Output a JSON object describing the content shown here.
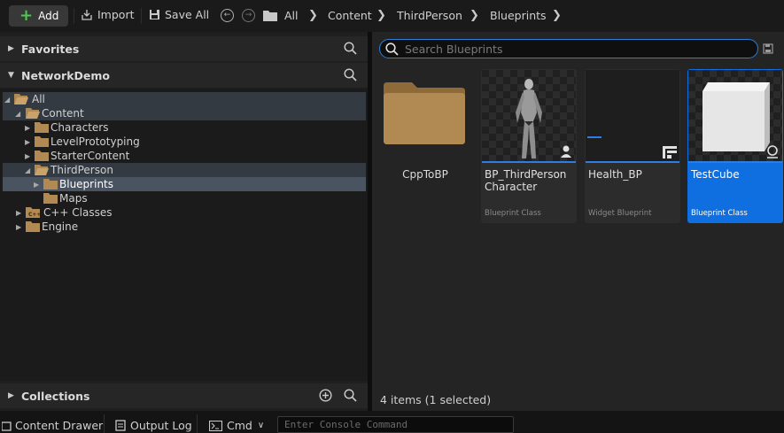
{
  "toolbar": {
    "add_label": "Add",
    "import_label": "Import",
    "save_all_label": "Save All",
    "breadcrumbs": [
      "All",
      "Content",
      "ThirdPerson",
      "Blueprints"
    ]
  },
  "sidebar": {
    "favorites_label": "Favorites",
    "project_label": "NetworkDemo",
    "collections_label": "Collections",
    "tree": [
      {
        "label": "All"
      },
      {
        "label": "Content"
      },
      {
        "label": "Characters"
      },
      {
        "label": "LevelPrototyping"
      },
      {
        "label": "StarterContent"
      },
      {
        "label": "ThirdPerson"
      },
      {
        "label": "Blueprints"
      },
      {
        "label": "Maps"
      },
      {
        "label": "C++ Classes"
      },
      {
        "label": "Engine"
      }
    ]
  },
  "content": {
    "search_placeholder": "Search Blueprints",
    "items": [
      {
        "name": "CppToBP",
        "type": ""
      },
      {
        "name": "BP_ThirdPerson Character",
        "type": "Blueprint Class"
      },
      {
        "name": "Health_BP",
        "type": "Widget Blueprint"
      },
      {
        "name": "TestCube",
        "type": "Blueprint Class"
      }
    ],
    "status": "4 items (1 selected)"
  },
  "bottom": {
    "content_drawer": "Content Drawer",
    "output_log": "Output Log",
    "cmd": "Cmd",
    "console_placeholder": "Enter Console Command"
  },
  "colors": {
    "accent": "#0f6fe0",
    "add_icon": "#4fc84f",
    "folder": "#b08a52",
    "blueprint_class_bar": "#2f7de0",
    "widget_bar": "#2f7de0"
  }
}
